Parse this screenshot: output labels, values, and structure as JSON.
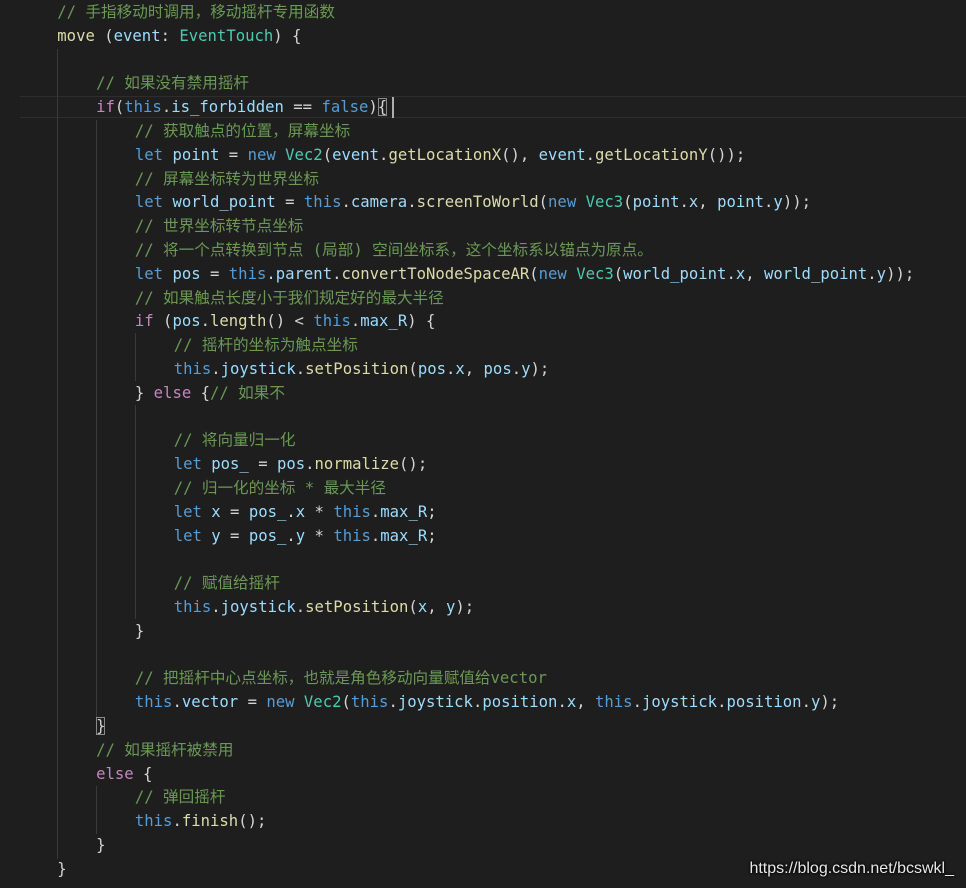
{
  "editor": {
    "lines": [
      {
        "indent": 1,
        "tokens": [
          {
            "t": "comment",
            "v": "// 手指移动时调用，移动摇杆专用函数"
          }
        ]
      },
      {
        "indent": 1,
        "tokens": [
          {
            "t": "func",
            "v": "move"
          },
          {
            "t": "punc",
            "v": " ("
          },
          {
            "t": "var",
            "v": "event"
          },
          {
            "t": "punc",
            "v": ": "
          },
          {
            "t": "type",
            "v": "EventTouch"
          },
          {
            "t": "punc",
            "v": ") {"
          }
        ]
      },
      {
        "indent": 0,
        "tokens": []
      },
      {
        "indent": 2,
        "tokens": [
          {
            "t": "comment",
            "v": "// 如果没有禁用摇杆"
          }
        ]
      },
      {
        "indent": 2,
        "tokens": [
          {
            "t": "control",
            "v": "if"
          },
          {
            "t": "punc",
            "v": "("
          },
          {
            "t": "keyword",
            "v": "this"
          },
          {
            "t": "punc",
            "v": "."
          },
          {
            "t": "var",
            "v": "is_forbidden"
          },
          {
            "t": "punc",
            "v": " == "
          },
          {
            "t": "keyword",
            "v": "false"
          },
          {
            "t": "punc",
            "v": ")"
          },
          {
            "t": "bracket",
            "v": "{"
          }
        ]
      },
      {
        "indent": 3,
        "tokens": [
          {
            "t": "comment",
            "v": "// 获取触点的位置，屏幕坐标"
          }
        ]
      },
      {
        "indent": 3,
        "tokens": [
          {
            "t": "keyword",
            "v": "let"
          },
          {
            "t": "punc",
            "v": " "
          },
          {
            "t": "var",
            "v": "point"
          },
          {
            "t": "punc",
            "v": " = "
          },
          {
            "t": "keyword",
            "v": "new"
          },
          {
            "t": "punc",
            "v": " "
          },
          {
            "t": "type",
            "v": "Vec2"
          },
          {
            "t": "punc",
            "v": "("
          },
          {
            "t": "var",
            "v": "event"
          },
          {
            "t": "punc",
            "v": "."
          },
          {
            "t": "func",
            "v": "getLocationX"
          },
          {
            "t": "punc",
            "v": "(), "
          },
          {
            "t": "var",
            "v": "event"
          },
          {
            "t": "punc",
            "v": "."
          },
          {
            "t": "func",
            "v": "getLocationY"
          },
          {
            "t": "punc",
            "v": "());"
          }
        ]
      },
      {
        "indent": 3,
        "tokens": [
          {
            "t": "comment",
            "v": "// 屏幕坐标转为世界坐标"
          }
        ]
      },
      {
        "indent": 3,
        "tokens": [
          {
            "t": "keyword",
            "v": "let"
          },
          {
            "t": "punc",
            "v": " "
          },
          {
            "t": "var",
            "v": "world_point"
          },
          {
            "t": "punc",
            "v": " = "
          },
          {
            "t": "keyword",
            "v": "this"
          },
          {
            "t": "punc",
            "v": "."
          },
          {
            "t": "var",
            "v": "camera"
          },
          {
            "t": "punc",
            "v": "."
          },
          {
            "t": "func",
            "v": "screenToWorld"
          },
          {
            "t": "punc",
            "v": "("
          },
          {
            "t": "keyword",
            "v": "new"
          },
          {
            "t": "punc",
            "v": " "
          },
          {
            "t": "type",
            "v": "Vec3"
          },
          {
            "t": "punc",
            "v": "("
          },
          {
            "t": "var",
            "v": "point"
          },
          {
            "t": "punc",
            "v": "."
          },
          {
            "t": "var",
            "v": "x"
          },
          {
            "t": "punc",
            "v": ", "
          },
          {
            "t": "var",
            "v": "point"
          },
          {
            "t": "punc",
            "v": "."
          },
          {
            "t": "var",
            "v": "y"
          },
          {
            "t": "punc",
            "v": "));"
          }
        ]
      },
      {
        "indent": 3,
        "tokens": [
          {
            "t": "comment",
            "v": "// 世界坐标转节点坐标"
          }
        ]
      },
      {
        "indent": 3,
        "tokens": [
          {
            "t": "comment",
            "v": "// 将一个点转换到节点 (局部) 空间坐标系，这个坐标系以锚点为原点。"
          }
        ]
      },
      {
        "indent": 3,
        "tokens": [
          {
            "t": "keyword",
            "v": "let"
          },
          {
            "t": "punc",
            "v": " "
          },
          {
            "t": "var",
            "v": "pos"
          },
          {
            "t": "punc",
            "v": " = "
          },
          {
            "t": "keyword",
            "v": "this"
          },
          {
            "t": "punc",
            "v": "."
          },
          {
            "t": "var",
            "v": "parent"
          },
          {
            "t": "punc",
            "v": "."
          },
          {
            "t": "func",
            "v": "convertToNodeSpaceAR"
          },
          {
            "t": "punc",
            "v": "("
          },
          {
            "t": "keyword",
            "v": "new"
          },
          {
            "t": "punc",
            "v": " "
          },
          {
            "t": "type",
            "v": "Vec3"
          },
          {
            "t": "punc",
            "v": "("
          },
          {
            "t": "var",
            "v": "world_point"
          },
          {
            "t": "punc",
            "v": "."
          },
          {
            "t": "var",
            "v": "x"
          },
          {
            "t": "punc",
            "v": ", "
          },
          {
            "t": "var",
            "v": "world_point"
          },
          {
            "t": "punc",
            "v": "."
          },
          {
            "t": "var",
            "v": "y"
          },
          {
            "t": "punc",
            "v": "));"
          }
        ]
      },
      {
        "indent": 3,
        "tokens": [
          {
            "t": "comment",
            "v": "// 如果触点长度小于我们规定好的最大半径"
          }
        ]
      },
      {
        "indent": 3,
        "tokens": [
          {
            "t": "control",
            "v": "if"
          },
          {
            "t": "punc",
            "v": " ("
          },
          {
            "t": "var",
            "v": "pos"
          },
          {
            "t": "punc",
            "v": "."
          },
          {
            "t": "func",
            "v": "length"
          },
          {
            "t": "punc",
            "v": "() < "
          },
          {
            "t": "keyword",
            "v": "this"
          },
          {
            "t": "punc",
            "v": "."
          },
          {
            "t": "var",
            "v": "max_R"
          },
          {
            "t": "punc",
            "v": ") {"
          }
        ]
      },
      {
        "indent": 4,
        "tokens": [
          {
            "t": "comment",
            "v": "// 摇杆的坐标为触点坐标"
          }
        ]
      },
      {
        "indent": 4,
        "tokens": [
          {
            "t": "keyword",
            "v": "this"
          },
          {
            "t": "punc",
            "v": "."
          },
          {
            "t": "var",
            "v": "joystick"
          },
          {
            "t": "punc",
            "v": "."
          },
          {
            "t": "func",
            "v": "setPosition"
          },
          {
            "t": "punc",
            "v": "("
          },
          {
            "t": "var",
            "v": "pos"
          },
          {
            "t": "punc",
            "v": "."
          },
          {
            "t": "var",
            "v": "x"
          },
          {
            "t": "punc",
            "v": ", "
          },
          {
            "t": "var",
            "v": "pos"
          },
          {
            "t": "punc",
            "v": "."
          },
          {
            "t": "var",
            "v": "y"
          },
          {
            "t": "punc",
            "v": ");"
          }
        ]
      },
      {
        "indent": 3,
        "tokens": [
          {
            "t": "punc",
            "v": "} "
          },
          {
            "t": "control",
            "v": "else"
          },
          {
            "t": "punc",
            "v": " {"
          },
          {
            "t": "comment",
            "v": "// 如果不"
          }
        ]
      },
      {
        "indent": 0,
        "tokens": []
      },
      {
        "indent": 4,
        "tokens": [
          {
            "t": "comment",
            "v": "// 将向量归一化"
          }
        ]
      },
      {
        "indent": 4,
        "tokens": [
          {
            "t": "keyword",
            "v": "let"
          },
          {
            "t": "punc",
            "v": " "
          },
          {
            "t": "var",
            "v": "pos_"
          },
          {
            "t": "punc",
            "v": " = "
          },
          {
            "t": "var",
            "v": "pos"
          },
          {
            "t": "punc",
            "v": "."
          },
          {
            "t": "func",
            "v": "normalize"
          },
          {
            "t": "punc",
            "v": "();"
          }
        ]
      },
      {
        "indent": 4,
        "tokens": [
          {
            "t": "comment",
            "v": "// 归一化的坐标 * 最大半径"
          }
        ]
      },
      {
        "indent": 4,
        "tokens": [
          {
            "t": "keyword",
            "v": "let"
          },
          {
            "t": "punc",
            "v": " "
          },
          {
            "t": "var",
            "v": "x"
          },
          {
            "t": "punc",
            "v": " = "
          },
          {
            "t": "var",
            "v": "pos_"
          },
          {
            "t": "punc",
            "v": "."
          },
          {
            "t": "var",
            "v": "x"
          },
          {
            "t": "punc",
            "v": " * "
          },
          {
            "t": "keyword",
            "v": "this"
          },
          {
            "t": "punc",
            "v": "."
          },
          {
            "t": "var",
            "v": "max_R"
          },
          {
            "t": "punc",
            "v": ";"
          }
        ]
      },
      {
        "indent": 4,
        "tokens": [
          {
            "t": "keyword",
            "v": "let"
          },
          {
            "t": "punc",
            "v": " "
          },
          {
            "t": "var",
            "v": "y"
          },
          {
            "t": "punc",
            "v": " = "
          },
          {
            "t": "var",
            "v": "pos_"
          },
          {
            "t": "punc",
            "v": "."
          },
          {
            "t": "var",
            "v": "y"
          },
          {
            "t": "punc",
            "v": " * "
          },
          {
            "t": "keyword",
            "v": "this"
          },
          {
            "t": "punc",
            "v": "."
          },
          {
            "t": "var",
            "v": "max_R"
          },
          {
            "t": "punc",
            "v": ";"
          }
        ]
      },
      {
        "indent": 0,
        "tokens": []
      },
      {
        "indent": 4,
        "tokens": [
          {
            "t": "comment",
            "v": "// 赋值给摇杆"
          }
        ]
      },
      {
        "indent": 4,
        "tokens": [
          {
            "t": "keyword",
            "v": "this"
          },
          {
            "t": "punc",
            "v": "."
          },
          {
            "t": "var",
            "v": "joystick"
          },
          {
            "t": "punc",
            "v": "."
          },
          {
            "t": "func",
            "v": "setPosition"
          },
          {
            "t": "punc",
            "v": "("
          },
          {
            "t": "var",
            "v": "x"
          },
          {
            "t": "punc",
            "v": ", "
          },
          {
            "t": "var",
            "v": "y"
          },
          {
            "t": "punc",
            "v": ");"
          }
        ]
      },
      {
        "indent": 3,
        "tokens": [
          {
            "t": "punc",
            "v": "}"
          }
        ]
      },
      {
        "indent": 0,
        "tokens": []
      },
      {
        "indent": 3,
        "tokens": [
          {
            "t": "comment",
            "v": "// 把摇杆中心点坐标，也就是角色移动向量赋值给vector"
          }
        ]
      },
      {
        "indent": 3,
        "tokens": [
          {
            "t": "keyword",
            "v": "this"
          },
          {
            "t": "punc",
            "v": "."
          },
          {
            "t": "var",
            "v": "vector"
          },
          {
            "t": "punc",
            "v": " = "
          },
          {
            "t": "keyword",
            "v": "new"
          },
          {
            "t": "punc",
            "v": " "
          },
          {
            "t": "type",
            "v": "Vec2"
          },
          {
            "t": "punc",
            "v": "("
          },
          {
            "t": "keyword",
            "v": "this"
          },
          {
            "t": "punc",
            "v": "."
          },
          {
            "t": "var",
            "v": "joystick"
          },
          {
            "t": "punc",
            "v": "."
          },
          {
            "t": "var",
            "v": "position"
          },
          {
            "t": "punc",
            "v": "."
          },
          {
            "t": "var",
            "v": "x"
          },
          {
            "t": "punc",
            "v": ", "
          },
          {
            "t": "keyword",
            "v": "this"
          },
          {
            "t": "punc",
            "v": "."
          },
          {
            "t": "var",
            "v": "joystick"
          },
          {
            "t": "punc",
            "v": "."
          },
          {
            "t": "var",
            "v": "position"
          },
          {
            "t": "punc",
            "v": "."
          },
          {
            "t": "var",
            "v": "y"
          },
          {
            "t": "punc",
            "v": ");"
          }
        ]
      },
      {
        "indent": 2,
        "tokens": [
          {
            "t": "bracket",
            "v": "}"
          }
        ]
      },
      {
        "indent": 2,
        "tokens": [
          {
            "t": "comment",
            "v": "// 如果摇杆被禁用"
          }
        ]
      },
      {
        "indent": 2,
        "tokens": [
          {
            "t": "control",
            "v": "else"
          },
          {
            "t": "punc",
            "v": " {"
          }
        ]
      },
      {
        "indent": 3,
        "tokens": [
          {
            "t": "comment",
            "v": "// 弹回摇杆"
          }
        ]
      },
      {
        "indent": 3,
        "tokens": [
          {
            "t": "keyword",
            "v": "this"
          },
          {
            "t": "punc",
            "v": "."
          },
          {
            "t": "func",
            "v": "finish"
          },
          {
            "t": "punc",
            "v": "();"
          }
        ]
      },
      {
        "indent": 2,
        "tokens": [
          {
            "t": "punc",
            "v": "}"
          }
        ]
      },
      {
        "indent": 1,
        "tokens": [
          {
            "t": "punc",
            "v": "}"
          }
        ]
      }
    ]
  },
  "watermark": "https://blog.csdn.net/bcswkl_"
}
